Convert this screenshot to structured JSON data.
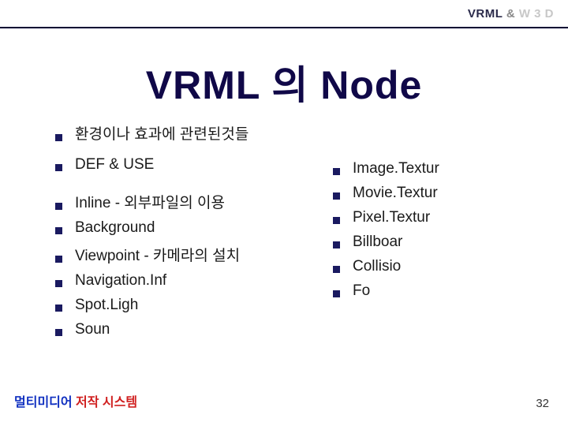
{
  "header": {
    "vrml": "VRML",
    "amp": " & ",
    "w3d": "W 3 D"
  },
  "title": "VRML 의 Node",
  "left": {
    "intro1": "환경이나 효과에 관련된것들",
    "intro2": "DEF & USE",
    "items": [
      "Inline - 외부파일의 이용",
      "Background",
      "Viewpoint - 카메라의 설치",
      "Navigation.Inf",
      " Spot.Ligh",
      "Soun"
    ]
  },
  "right": {
    "items": [
      "Image.Textur",
      "Movie.Textur",
      "Pixel.Textur",
      "Billboar",
      "Collisio",
      "Fo"
    ]
  },
  "footer": {
    "blue": "멀티미디어 ",
    "red": "저작 시스템",
    "page": "32"
  }
}
